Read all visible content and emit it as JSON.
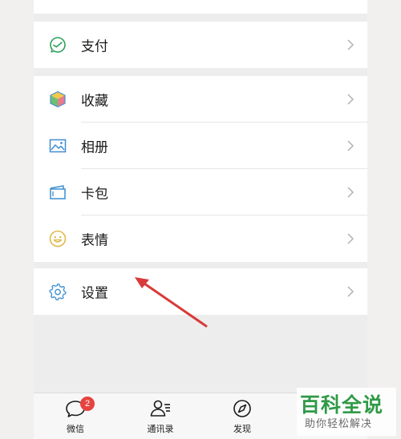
{
  "menu": {
    "pay": {
      "label": "支付",
      "icon": "wallet-icon"
    },
    "favorites": {
      "label": "收藏",
      "icon": "cube-icon"
    },
    "album": {
      "label": "相册",
      "icon": "photo-icon"
    },
    "cards": {
      "label": "卡包",
      "icon": "card-icon"
    },
    "stickers": {
      "label": "表情",
      "icon": "smiley-icon"
    },
    "settings": {
      "label": "设置",
      "icon": "gear-icon"
    }
  },
  "tabbar": {
    "chats": {
      "label": "微信",
      "badge": "2"
    },
    "contacts": {
      "label": "通讯录"
    },
    "discover": {
      "label": "发现"
    }
  },
  "watermark": {
    "title": "百科全说",
    "subtitle": "助你轻松解决"
  },
  "colors": {
    "accent_green": "#2f9a46",
    "badge_red": "#e64340",
    "annotation_arrow": "#d93a3a"
  }
}
